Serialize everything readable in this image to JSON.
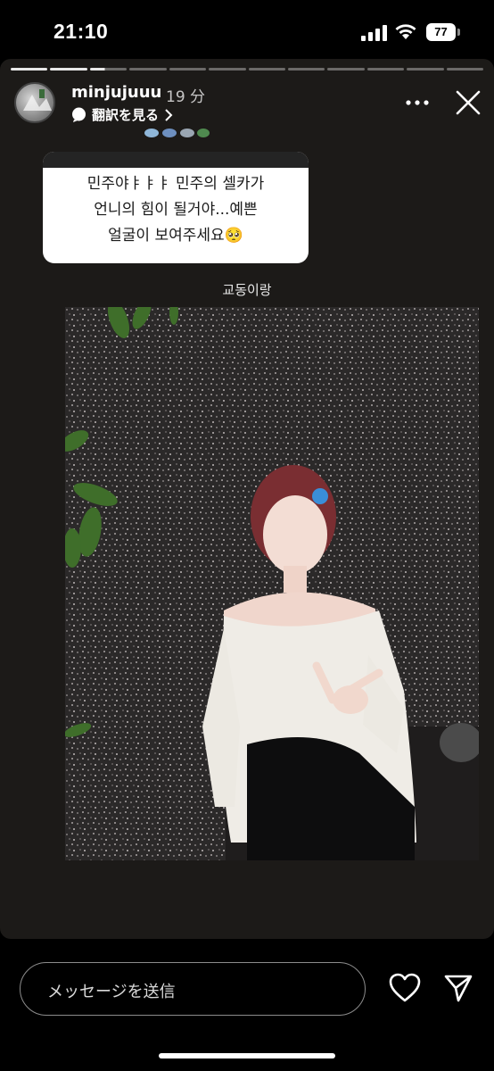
{
  "status_bar": {
    "time": "21:10",
    "battery": "77"
  },
  "story": {
    "username": "minjujuuu",
    "time_ago": "19 分",
    "translate_label": "翻訳を見る",
    "question_text": "민주야ㅑㅑㅑ 민주의 셀카가\n언니의 힘이 될거야...예쁜\n얼굴이 보여주세요🥺",
    "caption": "교동이랑"
  },
  "reply": {
    "placeholder": "メッセージを送信"
  }
}
